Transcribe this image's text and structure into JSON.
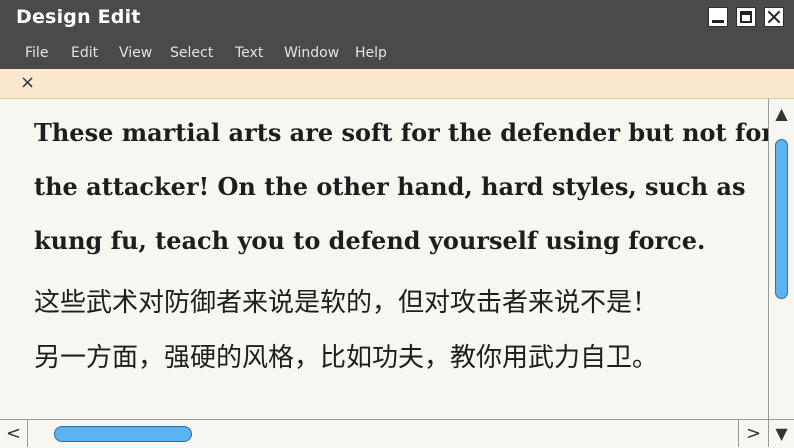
{
  "window": {
    "title": "Design Edit",
    "colors": {
      "titlebar": "#4a4a4a",
      "tabbar": "#fce7cf",
      "scroll_thumb": "#5ab3ee",
      "page": "#f8f6f1"
    }
  },
  "menu": {
    "items": [
      "File",
      "Edit",
      "View",
      "Select",
      "Text",
      "Window",
      "Help"
    ]
  },
  "tabbar": {
    "close_glyph": "×"
  },
  "document": {
    "english_lines": [
      "These martial arts are soft for the defender but not for",
      "the attacker! On the other hand, hard styles, such as",
      "kung fu, teach you to defend yourself using force."
    ],
    "chinese_lines": [
      "这些武术对防御者来说是软的，但对攻击者来说不是！",
      "另一方面，强硬的风格，比如功夫，教你用武力自卫。"
    ]
  },
  "scrollbars": {
    "up_glyph": "▲",
    "down_glyph": "▼",
    "left_glyph": "<",
    "right_glyph": ">"
  }
}
